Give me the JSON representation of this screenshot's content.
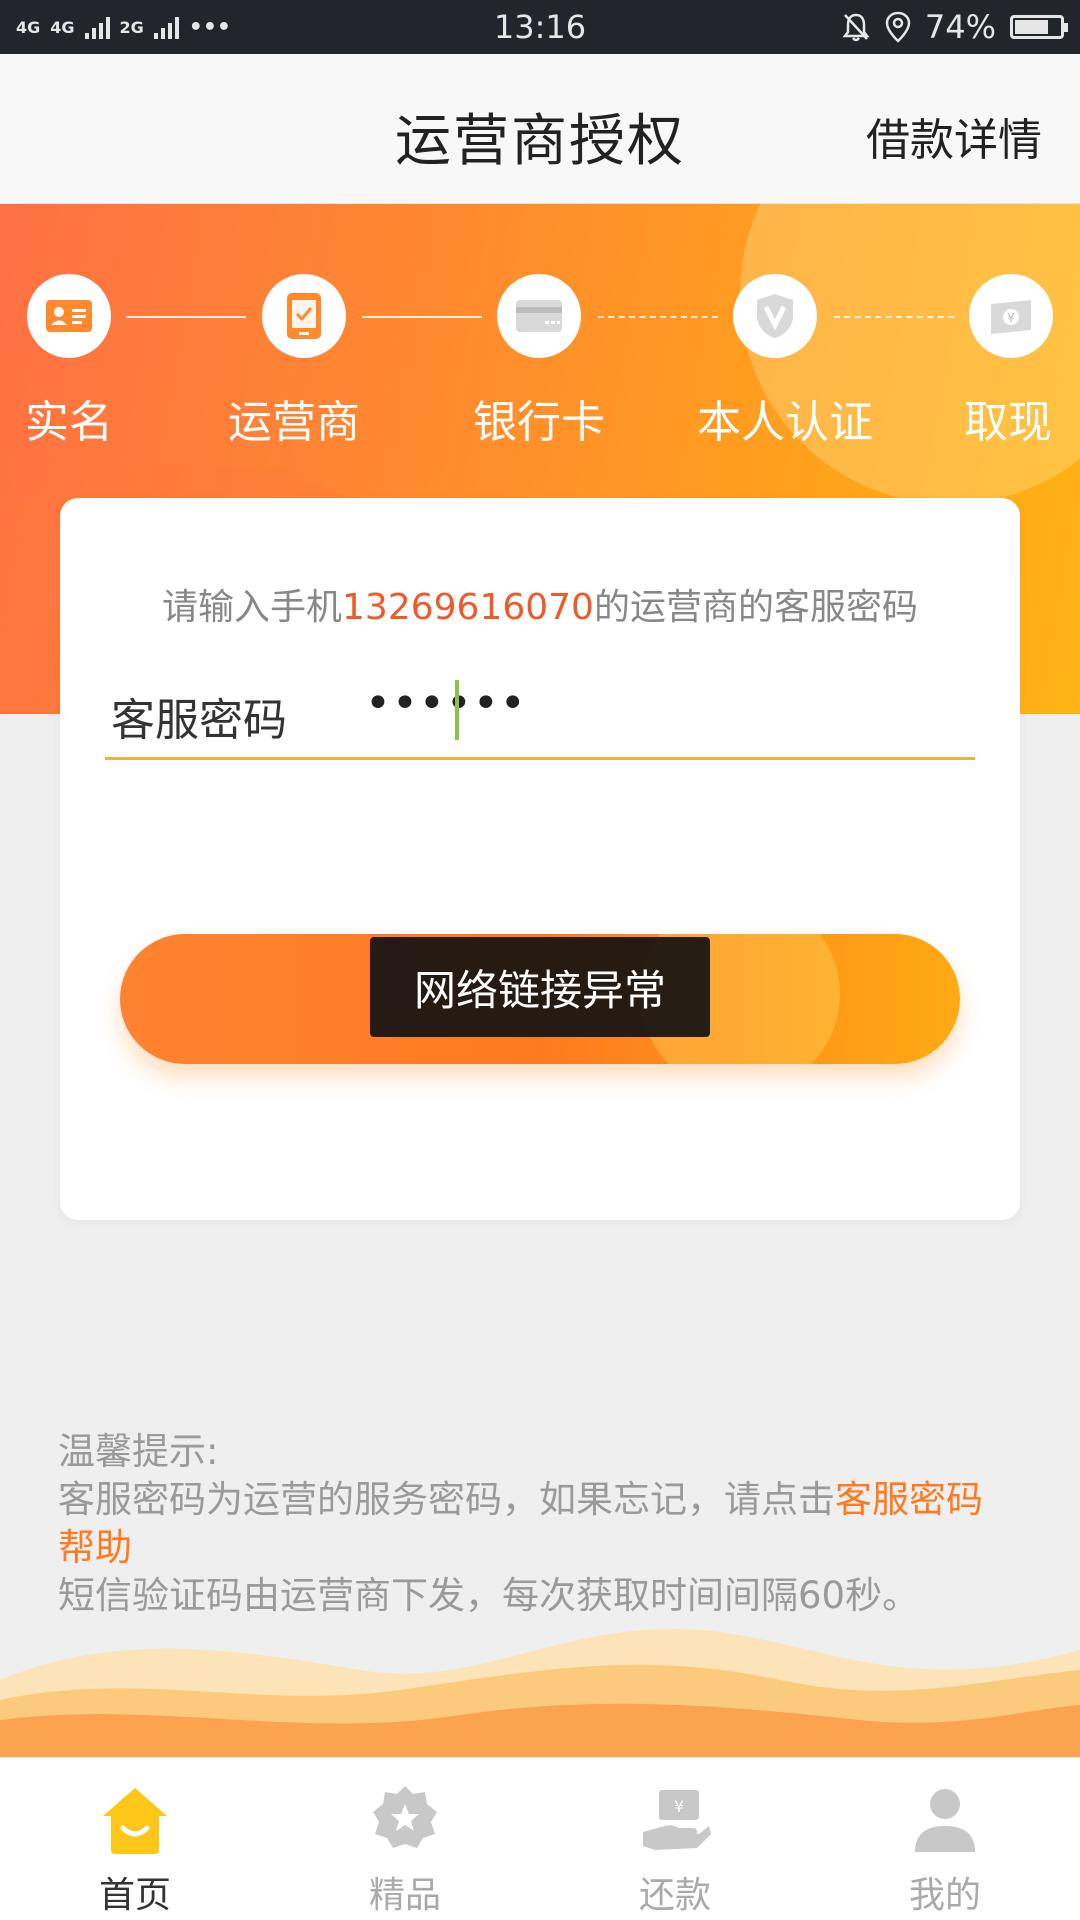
{
  "status_bar": {
    "network_left": "4G",
    "network_mid": "4G",
    "network_right": "2G",
    "dots": "•••",
    "time": "13:16",
    "battery": "74%"
  },
  "nav": {
    "title": "运营商授权",
    "action": "借款详情"
  },
  "steps": [
    {
      "label": "实名",
      "icon": "id-card-icon"
    },
    {
      "label": "运营商",
      "icon": "phone-check-icon"
    },
    {
      "label": "银行卡",
      "icon": "bank-card-icon"
    },
    {
      "label": "本人认证",
      "icon": "shield-v-icon"
    },
    {
      "label": "取现",
      "icon": "cash-icon"
    }
  ],
  "card": {
    "prompt_prefix": "请输入手机",
    "phone": "13269616070",
    "prompt_suffix": "的运营商的客服密码",
    "password_label": "客服密码",
    "password_value": "••••••"
  },
  "toast": "网络链接异常",
  "tips": {
    "title": "温馨提示:",
    "line1_prefix": "客服密码为运营的服务密码，如果忘记，请点击",
    "line1_link": "客服密码帮助",
    "line2": "短信验证码由运营商下发，每次获取时间间隔60秒。"
  },
  "tabs": [
    {
      "label": "首页",
      "icon": "home-icon",
      "active": true
    },
    {
      "label": "精品",
      "icon": "star-badge-icon",
      "active": false
    },
    {
      "label": "还款",
      "icon": "repay-hand-icon",
      "active": false
    },
    {
      "label": "我的",
      "icon": "user-icon",
      "active": false
    }
  ],
  "colors": {
    "accent": "#ff8a2e",
    "phone_red": "#ee5a2a",
    "link_orange": "#ff7a1f",
    "active_tab_icon": "#ffc61a"
  }
}
